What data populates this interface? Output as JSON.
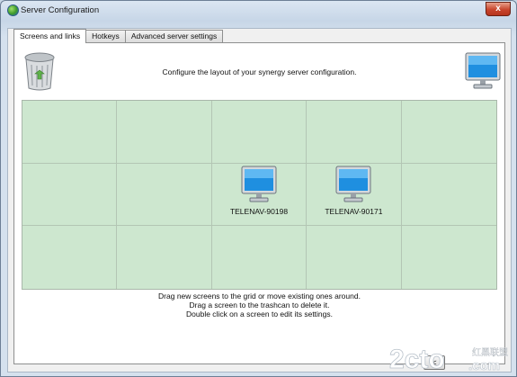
{
  "window": {
    "title": "Server Configuration",
    "close_label": "x"
  },
  "tabs": [
    {
      "label": "Screens and links",
      "active": true
    },
    {
      "label": "Hotkeys",
      "active": false
    },
    {
      "label": "Advanced server settings",
      "active": false
    }
  ],
  "panel": {
    "config_label": "Configure the layout of your synergy server configuration.",
    "grid": {
      "rows": 3,
      "columns": 5
    },
    "screens": [
      {
        "name": "TELENAV-90198",
        "row": 2,
        "column": 3
      },
      {
        "name": "TELENAV-90171",
        "row": 2,
        "column": 4
      }
    ],
    "instructions": [
      "Drag new screens to the grid or move existing ones around.",
      "Drag a screen to the trashcan to delete it.",
      "Double click on a screen to edit its settings."
    ]
  },
  "watermark": {
    "text_main": "2cto",
    "text_cn": "红黑联盟",
    "text_com": ".com"
  },
  "nav_button": {
    "label": "<"
  },
  "colors": {
    "grid_bg": "#cde7cf",
    "accent_title": "#c8452c",
    "monitor_screen": "#1f8fe0"
  }
}
